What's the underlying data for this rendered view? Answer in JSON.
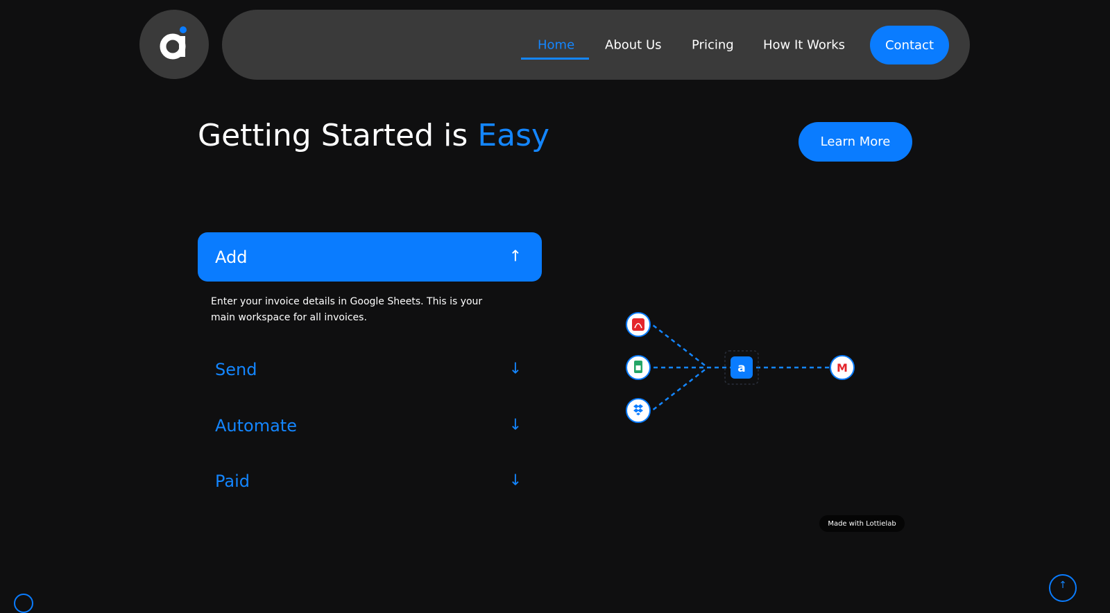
{
  "brand": {
    "logo_letter": "a",
    "accent_color": "#0a7cff"
  },
  "nav": {
    "items": [
      {
        "label": "Home",
        "active": true
      },
      {
        "label": "About Us"
      },
      {
        "label": "Pricing"
      },
      {
        "label": "How It Works"
      }
    ],
    "contact_label": "Contact"
  },
  "hero": {
    "title_main": "Getting Started is ",
    "title_accent": "Easy",
    "learn_more_label": "Learn More"
  },
  "steps": [
    {
      "title": "Add",
      "expanded": true,
      "arrow": "↑",
      "description": "Enter your invoice details in Google Sheets. This is your main workspace for all invoices."
    },
    {
      "title": "Send",
      "expanded": false,
      "arrow": "↓"
    },
    {
      "title": "Automate",
      "expanded": false,
      "arrow": "↓"
    },
    {
      "title": "Paid",
      "expanded": false,
      "arrow": "↓"
    }
  ],
  "diagram": {
    "sources": [
      "pdf-icon",
      "google-sheets-icon",
      "dropbox-icon"
    ],
    "hub_letter": "a",
    "destination": "gmail-icon",
    "gmail_letter": "M"
  },
  "badge": {
    "label": "Made with Lottielab"
  },
  "scroll_top": {
    "icon": "↑"
  }
}
